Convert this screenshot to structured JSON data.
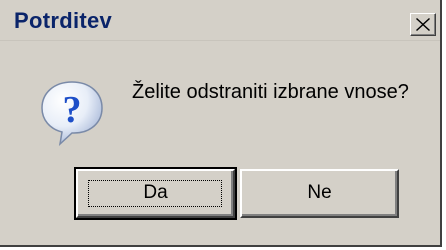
{
  "window": {
    "title": "Potrditev"
  },
  "message": "Želite odstraniti izbrane vnose?",
  "icons": {
    "dialog_icon": "question-icon",
    "close": "close-icon"
  },
  "buttons": {
    "yes_label": "Da",
    "no_label": "Ne"
  },
  "colors": {
    "title_text": "#0a246a",
    "face": "#d4d0c8",
    "icon_blue": "#1e4fc8"
  }
}
